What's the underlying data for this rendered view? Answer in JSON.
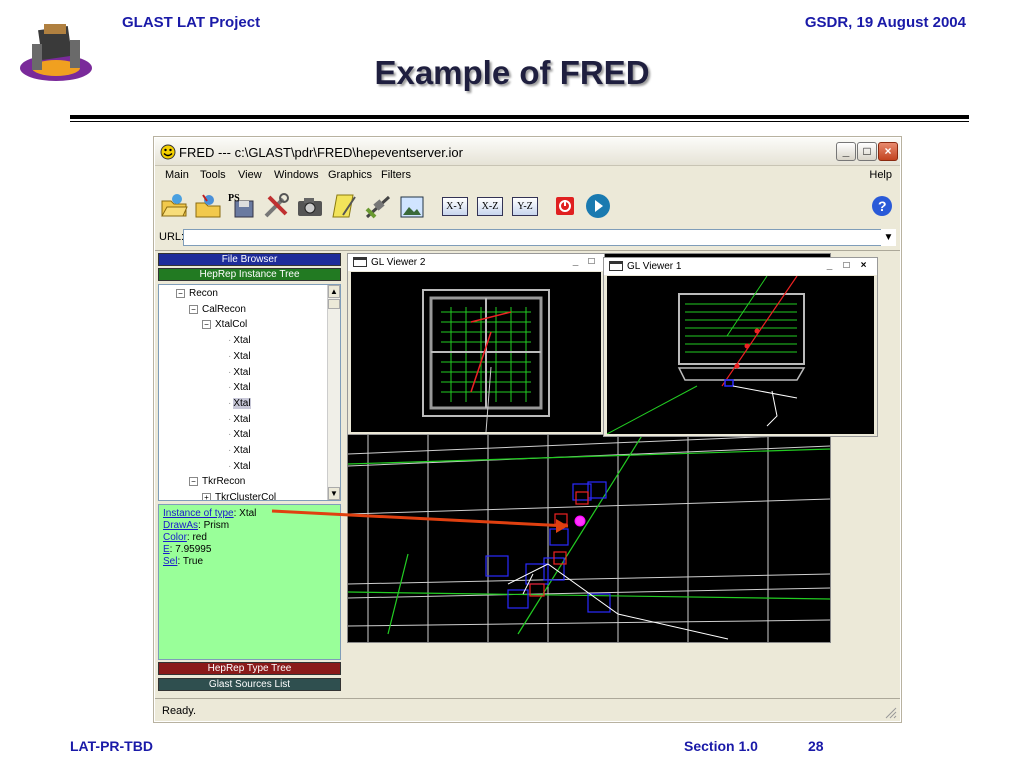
{
  "header": {
    "project": "GLAST LAT Project",
    "date": "GSDR, 19 August 2004"
  },
  "slide": {
    "title": "Example of FRED"
  },
  "footer": {
    "doc_id": "LAT-PR-TBD",
    "section": "Section 1.0",
    "page": "28"
  },
  "window": {
    "title": "FRED --- c:\\GLAST\\pdr\\FRED\\hepeventserver.ior",
    "controls": {
      "minimize": "_",
      "maximize": "□",
      "close": "×"
    }
  },
  "menu": {
    "items": [
      "Main",
      "Tools",
      "View",
      "Windows",
      "Graphics",
      "Filters"
    ],
    "help": "Help"
  },
  "toolbar": {
    "icons": [
      "open-folder-icon",
      "wizard-icon",
      "save-ps-icon",
      "tools-icon",
      "camera-icon",
      "notepad-icon",
      "satellite-icon",
      "image-icon",
      "xy-view-icon",
      "xz-view-icon",
      "yz-view-icon",
      "stop-icon",
      "play-icon",
      "help-icon"
    ],
    "ps_label": "PS",
    "xy": "X-Y",
    "xz": "X-Z",
    "yz": "Y-Z",
    "help_glyph": "?"
  },
  "url": {
    "label": "URL:",
    "value": "",
    "dropdown": "▼"
  },
  "left_panel": {
    "file_browser": "File Browser",
    "heprep_instance_tree": "HepRep Instance Tree",
    "heprep_type_tree": "HepRep Type Tree",
    "glast_sources_list": "Glast Sources List"
  },
  "tree": [
    {
      "label": "Recon",
      "expander": "−",
      "depth": 1
    },
    {
      "label": "CalRecon",
      "expander": "−",
      "depth": 2
    },
    {
      "label": "XtalCol",
      "expander": "−",
      "depth": 3
    },
    {
      "label": "Xtal",
      "expander": "",
      "depth": 4
    },
    {
      "label": "Xtal",
      "expander": "",
      "depth": 4
    },
    {
      "label": "Xtal",
      "expander": "",
      "depth": 4
    },
    {
      "label": "Xtal",
      "expander": "",
      "depth": 4
    },
    {
      "label": "Xtal",
      "expander": "",
      "depth": 4,
      "selected": true
    },
    {
      "label": "Xtal",
      "expander": "",
      "depth": 4
    },
    {
      "label": "Xtal",
      "expander": "",
      "depth": 4
    },
    {
      "label": "Xtal",
      "expander": "",
      "depth": 4
    },
    {
      "label": "Xtal",
      "expander": "",
      "depth": 4
    },
    {
      "label": "TkrRecon",
      "expander": "−",
      "depth": 2
    },
    {
      "label": "TkrClusterCol",
      "expander": "+",
      "depth": 3
    }
  ],
  "properties": [
    {
      "key": "Instance of type",
      "value": "Xtal"
    },
    {
      "key": "DrawAs",
      "value": "Prism"
    },
    {
      "key": "Color",
      "value": "red"
    },
    {
      "key": "E",
      "value": "7.95995"
    },
    {
      "key": "Sel",
      "value": "True"
    }
  ],
  "viewers": {
    "viewer2_title": "GL Viewer 2",
    "viewer1_title": "GL Viewer 1"
  },
  "status": {
    "text": "Ready."
  },
  "colors": {
    "header_text": "#1a1aa8",
    "file_browser": "#1e2c9a",
    "heprep_instance": "#227a22",
    "heprep_type": "#8a1a1a",
    "sources": "#2f4f4f",
    "props_bg": "#99ff99",
    "pointer_arrow": "#e04010"
  }
}
